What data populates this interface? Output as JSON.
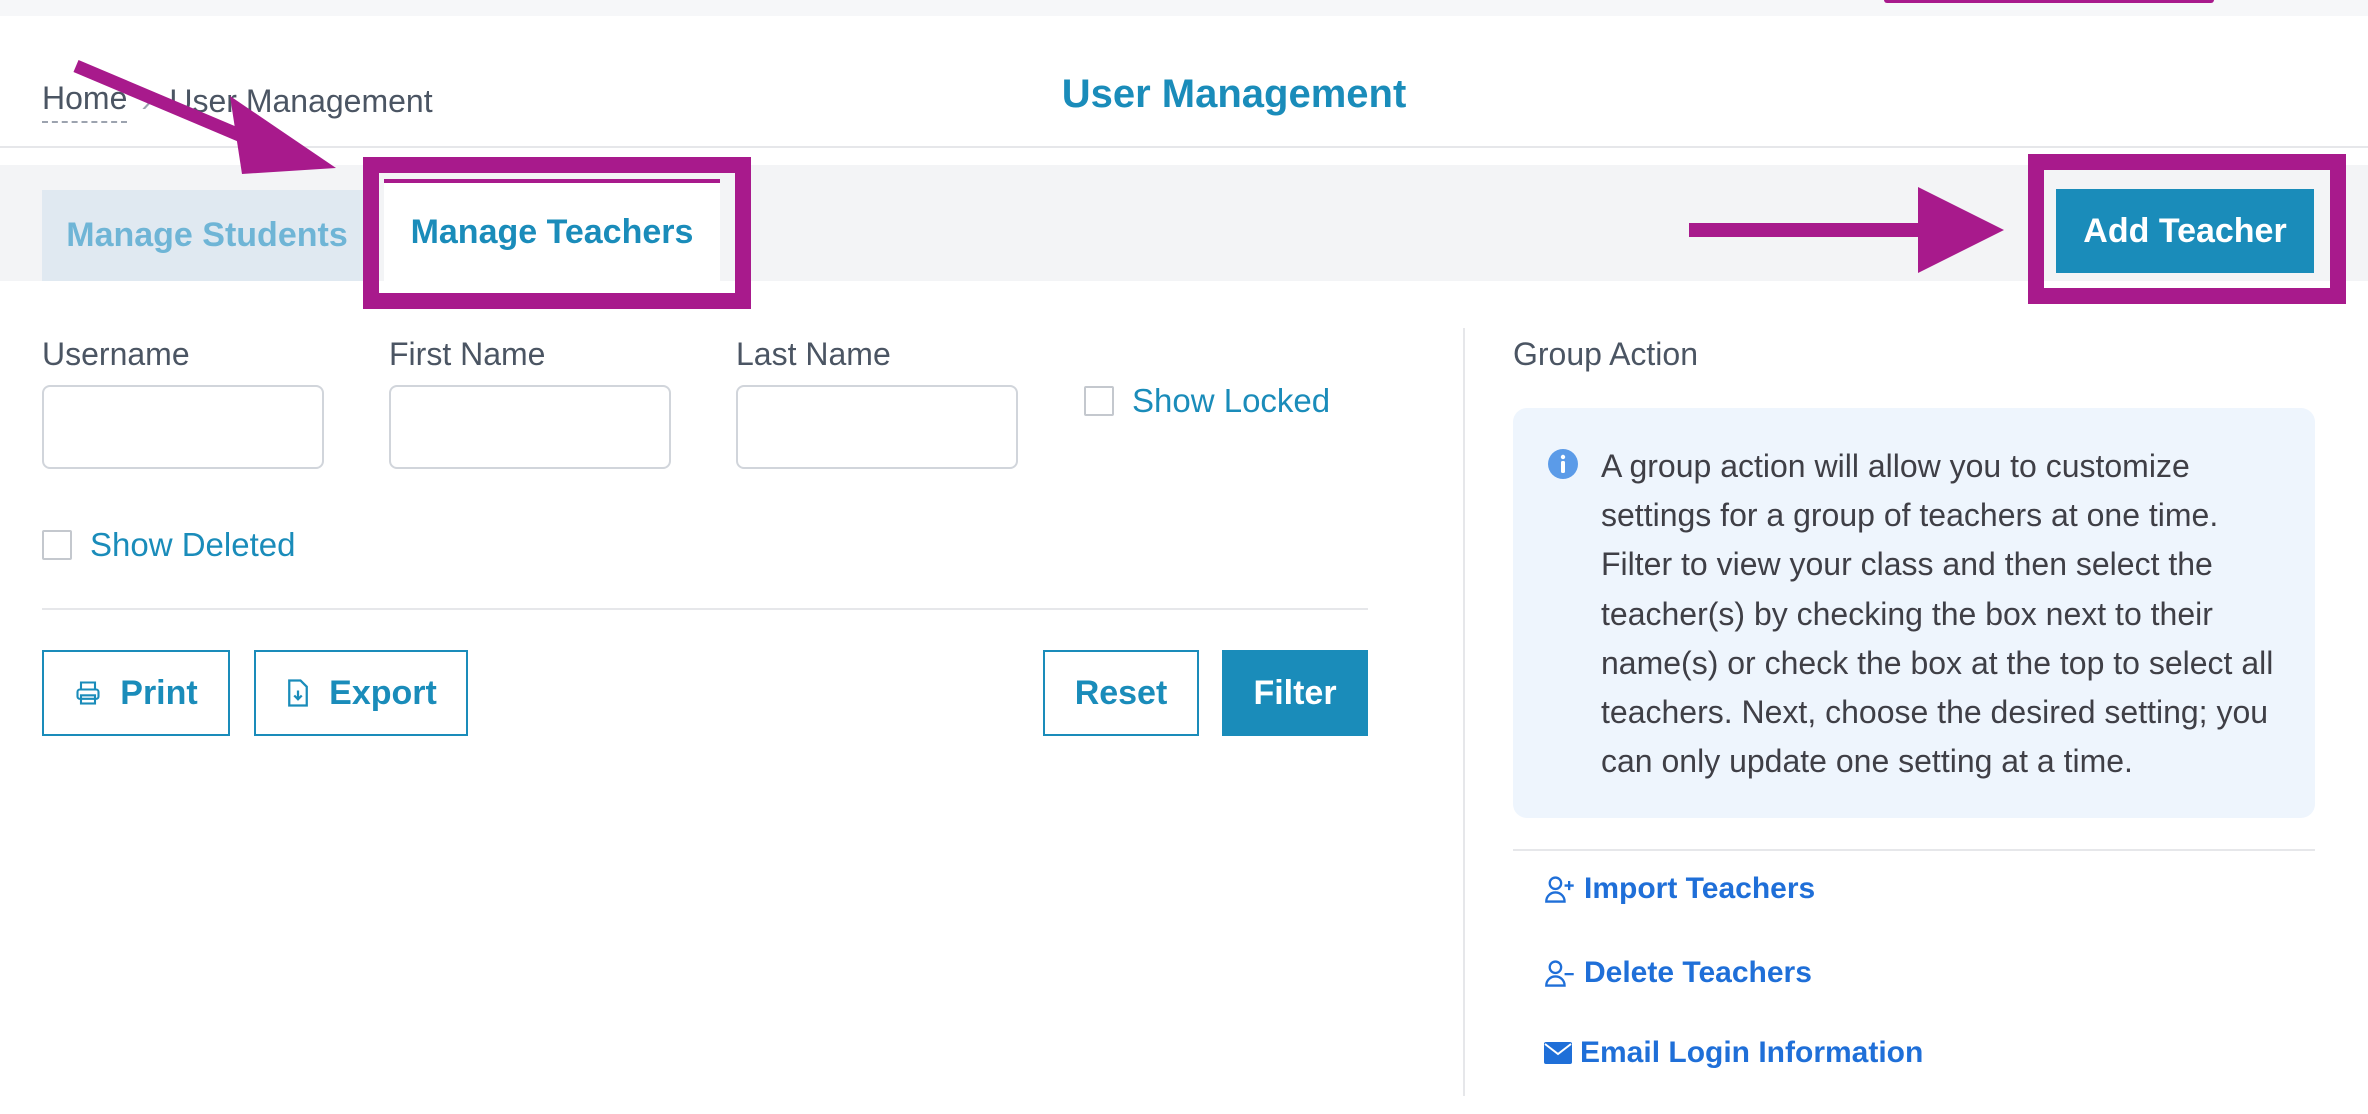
{
  "breadcrumb": {
    "home": "Home",
    "current": "User Management"
  },
  "header": {
    "title": "User Management"
  },
  "tabs": [
    {
      "label": "Manage Students",
      "active": false
    },
    {
      "label": "Manage Teachers",
      "active": true
    }
  ],
  "toolbar": {
    "add_teacher_label": "Add Teacher"
  },
  "filters": {
    "username_label": "Username",
    "username_value": "",
    "first_name_label": "First Name",
    "first_name_value": "",
    "last_name_label": "Last Name",
    "last_name_value": "",
    "show_locked_label": "Show Locked",
    "show_locked_checked": false,
    "show_deleted_label": "Show Deleted",
    "show_deleted_checked": false
  },
  "actions": {
    "print_label": "Print",
    "export_label": "Export",
    "reset_label": "Reset",
    "filter_label": "Filter"
  },
  "group_action": {
    "title": "Group Action",
    "info_text": "A group action will allow you to customize settings for a group of teachers at one time. Filter to view your class and then select the teacher(s) by checking the box next to their name(s) or check the box at the top to select all teachers. Next, choose the desired setting; you can only update one setting at a time.",
    "links": [
      {
        "label": "Import Teachers",
        "icon": "user-plus-icon"
      },
      {
        "label": "Delete Teachers",
        "icon": "user-minus-icon"
      },
      {
        "label": "Email Login Information",
        "icon": "envelope-icon"
      }
    ]
  },
  "colors": {
    "primary": "#1a8cba",
    "annotation": "#a81a8c",
    "link": "#1f6fd8",
    "info_background": "#eef5fd"
  }
}
